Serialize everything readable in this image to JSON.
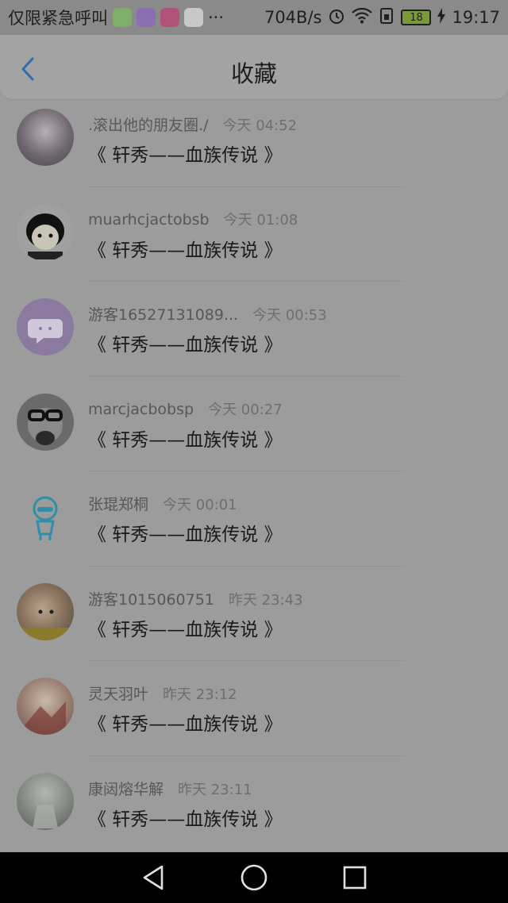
{
  "status_bar": {
    "carrier_text": "仅限紧急呼叫",
    "overflow": "···",
    "net_speed": "704B/s",
    "battery": "18",
    "time": "19:17"
  },
  "header": {
    "title": "收藏"
  },
  "items": [
    {
      "name": ".滚出他的朋友圈./",
      "time": "今天 04:52",
      "content": "《 轩秀——血族传说 》"
    },
    {
      "name": "muarhcjactobsb",
      "time": "今天 01:08",
      "content": "《 轩秀——血族传说 》"
    },
    {
      "name": "游客16527131089...",
      "time": "今天 00:53",
      "content": "《 轩秀——血族传说 》"
    },
    {
      "name": "marcjacbobsp",
      "time": "今天 00:27",
      "content": "《 轩秀——血族传说 》"
    },
    {
      "name": "张琨郑桐",
      "time": "今天 00:01",
      "content": "《 轩秀——血族传说 》"
    },
    {
      "name": "游客1015060751",
      "time": "昨天 23:43",
      "content": "《 轩秀——血族传说 》"
    },
    {
      "name": "灵天羽叶",
      "time": "昨天 23:12",
      "content": "《 轩秀——血族传说 》"
    },
    {
      "name": "康闼熔华解",
      "time": "昨天 23:11",
      "content": "《 轩秀——血族传说 》"
    }
  ],
  "colors": {
    "accent": "#2b6fb0",
    "overlay": "#9c9c9c"
  }
}
